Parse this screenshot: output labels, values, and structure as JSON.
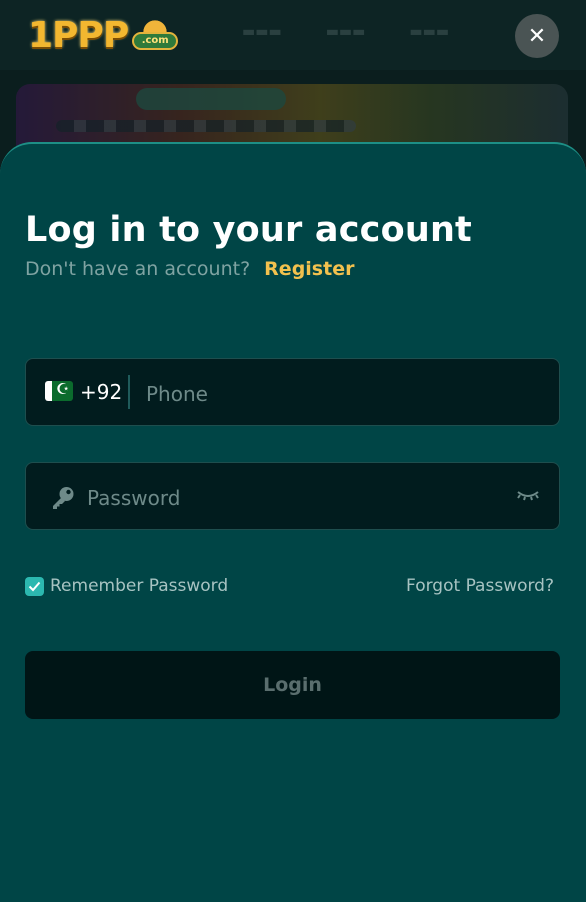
{
  "header": {
    "logo_text": "1PPP",
    "logo_badge": ".com",
    "close_label": "✕"
  },
  "login": {
    "title": "Log in to your account",
    "no_account_text": "Don't have an account?",
    "register_label": "Register",
    "phone": {
      "country_code": "+92",
      "placeholder": "Phone",
      "value": ""
    },
    "password": {
      "placeholder": "Password",
      "value": ""
    },
    "remember_label": "Remember Password",
    "remember_checked": true,
    "forgot_label": "Forgot Password?",
    "submit_label": "Login"
  },
  "icons": {
    "flag": "pakistan-flag-icon",
    "password": "key-icon",
    "toggle_visibility": "eye-closed-icon",
    "checkbox": "checkmark-icon",
    "close": "close-icon"
  },
  "colors": {
    "sheet_bg": "#004546",
    "input_bg": "#011c1e",
    "accent": "#2cb8b0",
    "register_link": "#f2c14e",
    "button_bg": "#001516"
  }
}
